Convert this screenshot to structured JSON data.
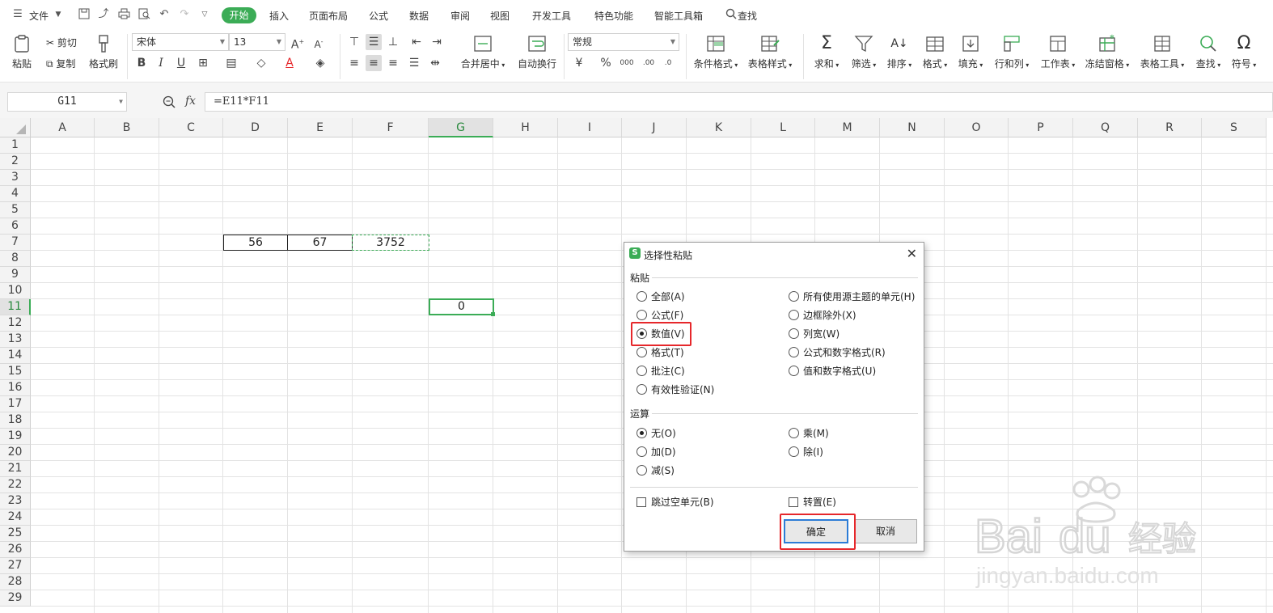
{
  "menubar": {
    "file": "文件",
    "tabs": [
      "开始",
      "插入",
      "页面布局",
      "公式",
      "数据",
      "审阅",
      "视图",
      "开发工具",
      "特色功能",
      "智能工具箱"
    ],
    "search": "查找"
  },
  "ribbon": {
    "paste": "粘贴",
    "cut": "剪切",
    "copy": "复制",
    "format_painter": "格式刷",
    "font_name": "宋体",
    "font_size": "13",
    "merge_center": "合并居中",
    "wrap_text": "自动换行",
    "number_format": "常规",
    "conditional_format": "条件格式",
    "table_style": "表格样式",
    "sum": "求和",
    "filter": "筛选",
    "sort": "排序",
    "format": "格式",
    "fill": "填充",
    "row_col": "行和列",
    "worksheet": "工作表",
    "freeze": "冻结窗格",
    "table_tools": "表格工具",
    "find": "查找",
    "symbol": "符号"
  },
  "formulabar": {
    "name_box": "G11",
    "fx": "fx",
    "formula": "=E11*F11"
  },
  "grid": {
    "columns": [
      "A",
      "B",
      "C",
      "D",
      "E",
      "F",
      "G",
      "H",
      "I",
      "J",
      "K",
      "L",
      "M",
      "N",
      "O",
      "P",
      "Q",
      "R",
      "S"
    ],
    "rows": [
      "1",
      "2",
      "3",
      "4",
      "5",
      "6",
      "7",
      "8",
      "9",
      "10",
      "11",
      "12",
      "13",
      "14",
      "15",
      "16",
      "17",
      "18",
      "19",
      "20",
      "21",
      "22",
      "23",
      "24",
      "25",
      "26",
      "27",
      "28",
      "29"
    ],
    "selected_column": "G",
    "selected_row": "11",
    "cells": {
      "D7": "56",
      "E7": "67",
      "F7": "3752",
      "G11": "0"
    }
  },
  "dialog": {
    "title": "选择性粘贴",
    "paste_group": "粘贴",
    "paste_left": [
      "全部(A)",
      "公式(F)",
      "数值(V)",
      "格式(T)",
      "批注(C)",
      "有效性验证(N)"
    ],
    "paste_right": [
      "所有使用源主题的单元(H)",
      "边框除外(X)",
      "列宽(W)",
      "公式和数字格式(R)",
      "值和数字格式(U)"
    ],
    "paste_selected": "数值(V)",
    "operation_group": "运算",
    "op_left": [
      "无(O)",
      "加(D)",
      "减(S)"
    ],
    "op_right": [
      "乘(M)",
      "除(I)"
    ],
    "op_selected": "无(O)",
    "skip_blanks": "跳过空单元(B)",
    "transpose": "转置(E)",
    "ok": "确定",
    "cancel": "取消"
  },
  "colors": {
    "accent": "#3bac56",
    "highlight": "#e6272b",
    "focus": "#2c7cd6"
  }
}
